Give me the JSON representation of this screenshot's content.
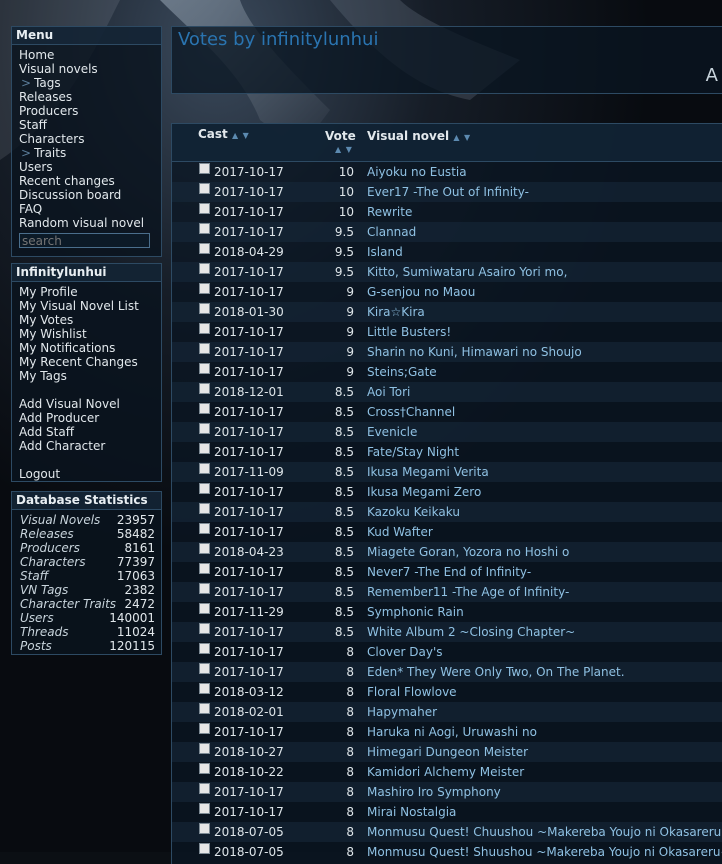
{
  "menu": {
    "title": "Menu",
    "items": [
      "Home",
      "Visual novels",
      "Tags",
      "Releases",
      "Producers",
      "Staff",
      "Characters",
      "Traits",
      "Users",
      "Recent changes",
      "Discussion board",
      "FAQ",
      "Random visual novel"
    ],
    "sub_marker": ">",
    "search_placeholder": "search"
  },
  "user": {
    "title": "Infinitylunhui",
    "links": [
      "My Profile",
      "My Visual Novel List",
      "My Votes",
      "My Wishlist",
      "My Notifications",
      "My Recent Changes",
      "My Tags"
    ],
    "add_links": [
      "Add Visual Novel",
      "Add Producer",
      "Add Staff",
      "Add Character"
    ],
    "logout": "Logout"
  },
  "stats": {
    "title": "Database Statistics",
    "rows": [
      {
        "label": "Visual Novels",
        "value": "23957"
      },
      {
        "label": "Releases",
        "value": "58482"
      },
      {
        "label": "Producers",
        "value": "8161"
      },
      {
        "label": "Characters",
        "value": "77397"
      },
      {
        "label": "Staff",
        "value": "17063"
      },
      {
        "label": "VN Tags",
        "value": "2382"
      },
      {
        "label": "Character Traits",
        "value": "2472"
      },
      {
        "label": "Users",
        "value": "140001"
      },
      {
        "label": "Threads",
        "value": "11024"
      },
      {
        "label": "Posts",
        "value": "120115"
      }
    ]
  },
  "header": {
    "title": "Votes by infinitylunhui",
    "edge_text": "A"
  },
  "table": {
    "col_cast": "Cast",
    "col_vote": "Vote",
    "col_vn": "Visual novel",
    "sort_glyphs": "▲ ▼",
    "rows": [
      {
        "date": "2017-10-17",
        "vote": "10",
        "vn": "Aiyoku no Eustia"
      },
      {
        "date": "2017-10-17",
        "vote": "10",
        "vn": "Ever17 -The Out of Infinity-"
      },
      {
        "date": "2017-10-17",
        "vote": "10",
        "vn": "Rewrite"
      },
      {
        "date": "2017-10-17",
        "vote": "9.5",
        "vn": "Clannad"
      },
      {
        "date": "2018-04-29",
        "vote": "9.5",
        "vn": "Island"
      },
      {
        "date": "2017-10-17",
        "vote": "9.5",
        "vn": "Kitto, Sumiwataru Asairo Yori mo,"
      },
      {
        "date": "2017-10-17",
        "vote": "9",
        "vn": "G-senjou no Maou"
      },
      {
        "date": "2018-01-30",
        "vote": "9",
        "vn": "Kira☆Kira"
      },
      {
        "date": "2017-10-17",
        "vote": "9",
        "vn": "Little Busters!"
      },
      {
        "date": "2017-10-17",
        "vote": "9",
        "vn": "Sharin no Kuni, Himawari no Shoujo"
      },
      {
        "date": "2017-10-17",
        "vote": "9",
        "vn": "Steins;Gate"
      },
      {
        "date": "2018-12-01",
        "vote": "8.5",
        "vn": "Aoi Tori"
      },
      {
        "date": "2017-10-17",
        "vote": "8.5",
        "vn": "Cross†Channel"
      },
      {
        "date": "2017-10-17",
        "vote": "8.5",
        "vn": "Evenicle"
      },
      {
        "date": "2017-10-17",
        "vote": "8.5",
        "vn": "Fate/Stay Night"
      },
      {
        "date": "2017-11-09",
        "vote": "8.5",
        "vn": "Ikusa Megami Verita"
      },
      {
        "date": "2017-10-17",
        "vote": "8.5",
        "vn": "Ikusa Megami Zero"
      },
      {
        "date": "2017-10-17",
        "vote": "8.5",
        "vn": "Kazoku Keikaku"
      },
      {
        "date": "2017-10-17",
        "vote": "8.5",
        "vn": "Kud Wafter"
      },
      {
        "date": "2018-04-23",
        "vote": "8.5",
        "vn": "Miagete Goran, Yozora no Hoshi o"
      },
      {
        "date": "2017-10-17",
        "vote": "8.5",
        "vn": "Never7 -The End of Infinity-"
      },
      {
        "date": "2017-10-17",
        "vote": "8.5",
        "vn": "Remember11 -The Age of Infinity-"
      },
      {
        "date": "2017-11-29",
        "vote": "8.5",
        "vn": "Symphonic Rain"
      },
      {
        "date": "2017-10-17",
        "vote": "8.5",
        "vn": "White Album 2 ~Closing Chapter~"
      },
      {
        "date": "2017-10-17",
        "vote": "8",
        "vn": "Clover Day's"
      },
      {
        "date": "2017-10-17",
        "vote": "8",
        "vn": "Eden* They Were Only Two, On The Planet."
      },
      {
        "date": "2018-03-12",
        "vote": "8",
        "vn": "Floral Flowlove"
      },
      {
        "date": "2018-02-01",
        "vote": "8",
        "vn": "Hapymaher"
      },
      {
        "date": "2017-10-17",
        "vote": "8",
        "vn": "Haruka ni Aogi, Uruwashi no"
      },
      {
        "date": "2018-10-27",
        "vote": "8",
        "vn": "Himegari Dungeon Meister"
      },
      {
        "date": "2018-10-22",
        "vote": "8",
        "vn": "Kamidori Alchemy Meister"
      },
      {
        "date": "2017-10-17",
        "vote": "8",
        "vn": "Mashiro Iro Symphony"
      },
      {
        "date": "2017-10-17",
        "vote": "8",
        "vn": "Mirai Nostalgia"
      },
      {
        "date": "2018-07-05",
        "vote": "8",
        "vn": "Monmusu Quest! Chuushou ~Makereba Youjo ni Okasareru~"
      },
      {
        "date": "2018-07-05",
        "vote": "8",
        "vn": "Monmusu Quest! Shuushou ~Makereba Youjo ni Okasareru~"
      }
    ]
  },
  "colors": {
    "accent": "#2a74b0",
    "link": "#8fc1e3",
    "border": "#2d4a63"
  }
}
